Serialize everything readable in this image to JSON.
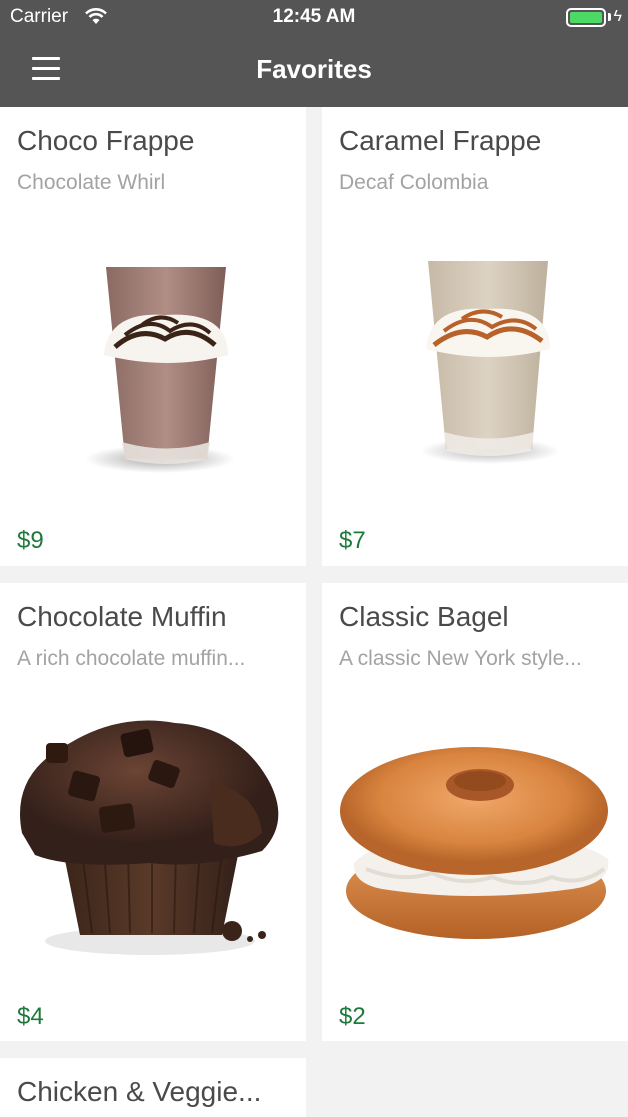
{
  "status_bar": {
    "carrier": "Carrier",
    "time": "12:45 AM",
    "battery_color": "#4cd964"
  },
  "header": {
    "title": "Favorites",
    "menu_icon": "hamburger-menu-icon",
    "background": "#555555"
  },
  "products": [
    {
      "name": "Choco Frappe",
      "description": "Chocolate Whirl",
      "price": "$9",
      "image": "chocolate-frappe-image"
    },
    {
      "name": "Caramel Frappe",
      "description": "Decaf Colombia",
      "price": "$7",
      "image": "caramel-frappe-image"
    },
    {
      "name": "Chocolate Muffin",
      "description": "A rich chocolate muffin...",
      "price": "$4",
      "image": "chocolate-muffin-image"
    },
    {
      "name": "Classic Bagel",
      "description": "A classic New York style...",
      "price": "$2",
      "image": "bagel-image"
    },
    {
      "name": "Chicken & Veggie...",
      "description": "",
      "price": "",
      "image": ""
    }
  ],
  "colors": {
    "price": "#1e7a3a",
    "background": "#f2f2f2"
  }
}
